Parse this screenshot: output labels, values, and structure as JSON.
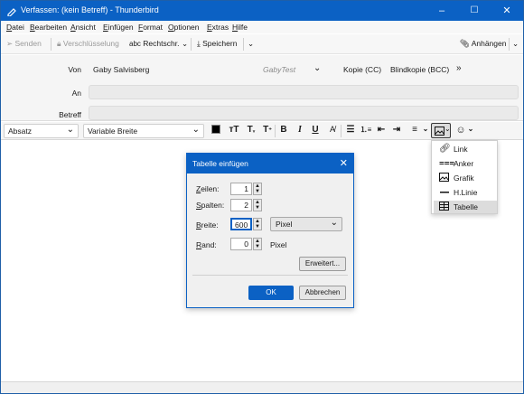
{
  "window": {
    "title": "Verfassen: (kein Betreff) - Thunderbird",
    "controls": [
      "–",
      "☐",
      "✕"
    ]
  },
  "menu": [
    "Datei",
    "Bearbeiten",
    "Ansicht",
    "Einfügen",
    "Format",
    "Optionen",
    "Extras",
    "Hilfe"
  ],
  "toolbar": {
    "send": "Senden",
    "encryption": "Verschlüsselung",
    "spelling": "Rechtschr.",
    "save": "Speichern",
    "attach": "Anhängen"
  },
  "header": {
    "from_label": "Von",
    "from_value": "Gaby Salvisberg",
    "from_identity": "GabyTest",
    "cc": "Kopie (CC)",
    "bcc": "Blindkopie (BCC)",
    "to_label": "An",
    "subject_label": "Betreff"
  },
  "format": {
    "paragraph": "Absatz",
    "font": "Variable Breite"
  },
  "dialog": {
    "title": "Tabelle einfügen",
    "rows_label": "Zeilen:",
    "rows_value": "1",
    "cols_label": "Spalten:",
    "cols_value": "2",
    "width_label": "Breite:",
    "width_value": "600",
    "width_unit": "Pixel",
    "border_label": "Rand:",
    "border_value": "0",
    "border_unit": "Pixel",
    "advanced": "Erweitert...",
    "ok": "OK",
    "cancel": "Abbrechen"
  },
  "insert_menu": [
    "Link",
    "Anker",
    "Grafik",
    "H.Linie",
    "Tabelle"
  ],
  "colors": {
    "accent": "#0b61c4",
    "selected_item": "#dcdcdc"
  }
}
